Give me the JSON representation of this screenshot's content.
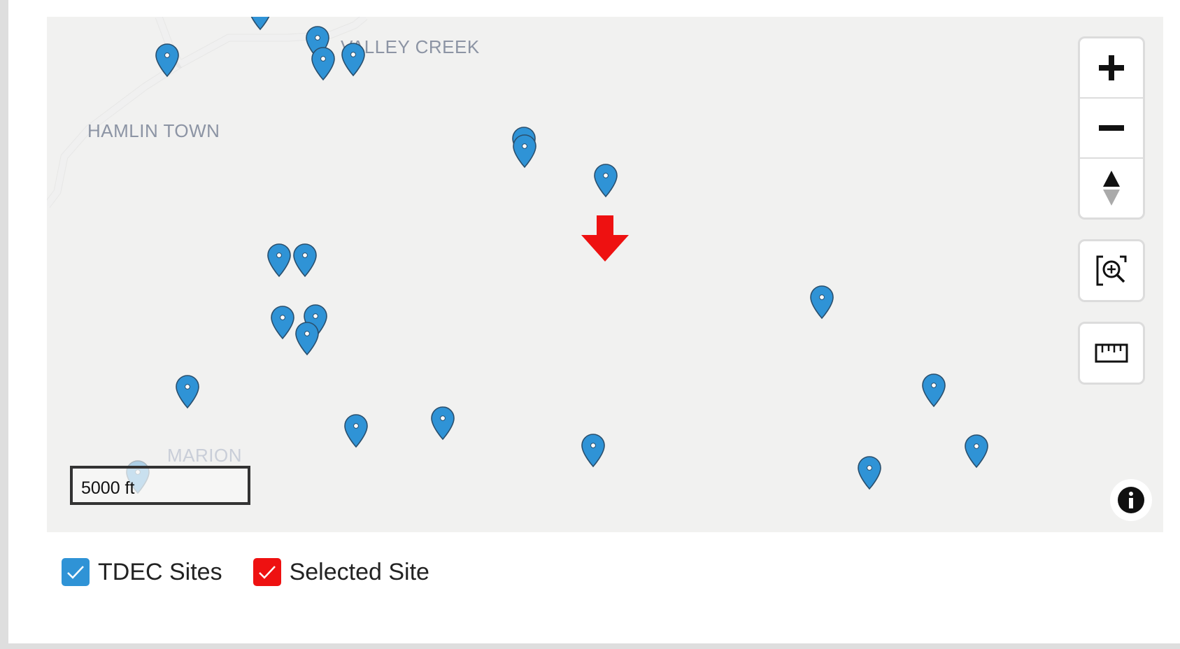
{
  "map": {
    "places": [
      {
        "name": "VALLEY CREEK"
      },
      {
        "name": "HAMLIN TOWN"
      },
      {
        "name": "MARION"
      }
    ],
    "marker_color": "#2f93d6",
    "selected_color": "#ee1111",
    "scale_label": "5000 ft"
  },
  "controls": {
    "zoom_in_icon": "plus-icon",
    "zoom_out_icon": "minus-icon",
    "compass_icon": "compass-icon",
    "zoom_to_icon": "zoom-magnifier-icon",
    "measure_icon": "ruler-icon",
    "info_icon": "info-icon"
  },
  "legend": {
    "items": [
      {
        "label": "TDEC Sites",
        "color": "#2f93d6",
        "checked": true
      },
      {
        "label": "Selected Site",
        "color": "#ee1111",
        "checked": true
      }
    ]
  }
}
